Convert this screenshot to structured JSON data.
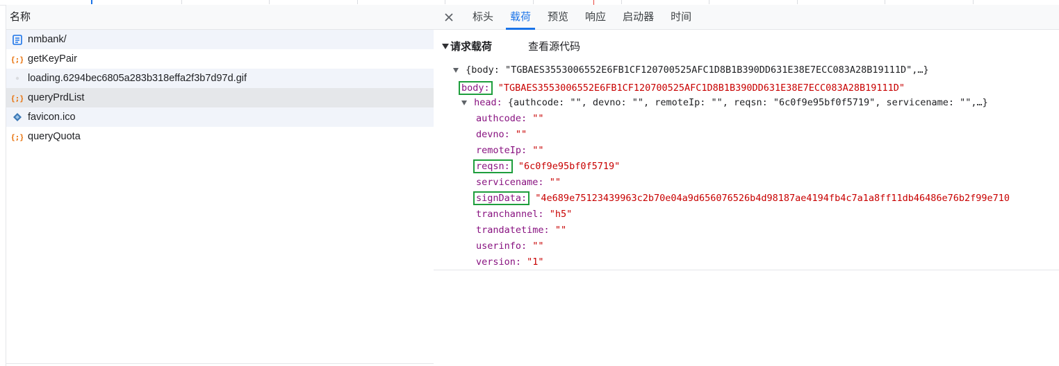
{
  "requests_panel": {
    "header": "名称",
    "items": [
      {
        "name": "nmbank/",
        "icon": "document-icon",
        "state": "alt"
      },
      {
        "name": "getKeyPair",
        "icon": "fetch-icon",
        "state": "plain"
      },
      {
        "name": "loading.6294bec6805a283b318effa2f3b7d97d.gif",
        "icon": "image-icon",
        "state": "alt"
      },
      {
        "name": "queryPrdList",
        "icon": "fetch-icon",
        "state": "selected"
      },
      {
        "name": "favicon.ico",
        "icon": "favicon-icon",
        "state": "alt"
      },
      {
        "name": "queryQuota",
        "icon": "fetch-icon",
        "state": "plain"
      }
    ]
  },
  "detail": {
    "close_icon": "close-icon",
    "tabs": [
      "标头",
      "载荷",
      "预览",
      "响应",
      "启动器",
      "时间"
    ],
    "active_tab": "载荷",
    "payload": {
      "section_title": "请求载荷",
      "view_source": "查看源代码",
      "summary": "{body: \"TGBAES3553006552E6FB1CF120700525AFC1D8B1B390DD631E38E7ECC083A28B19111D\",…}",
      "body_key": "body:",
      "body_value": "\"TGBAES3553006552E6FB1CF120700525AFC1D8B1B390DD631E38E7ECC083A28B19111D\"",
      "head_key": "head:",
      "head_summary": "{authcode: \"\", devno: \"\", remoteIp: \"\", reqsn: \"6c0f9e95bf0f5719\", servicename: \"\",…}",
      "fields": [
        {
          "key": "authcode:",
          "value": "\"\"",
          "highlight": false
        },
        {
          "key": "devno:",
          "value": "\"\"",
          "highlight": false
        },
        {
          "key": "remoteIp:",
          "value": "\"\"",
          "highlight": false
        },
        {
          "key": "reqsn:",
          "value": "\"6c0f9e95bf0f5719\"",
          "highlight": true
        },
        {
          "key": "servicename:",
          "value": "\"\"",
          "highlight": false
        },
        {
          "key": "signData:",
          "value": "\"4e689e75123439963c2b70e04a9d656076526b4d98187ae4194fb4c7a1a8ff11db46486e76b2f99e710",
          "highlight": true
        },
        {
          "key": "tranchannel:",
          "value": "\"h5\"",
          "highlight": false
        },
        {
          "key": "trandatetime:",
          "value": "\"\"",
          "highlight": false
        },
        {
          "key": "userinfo:",
          "value": "\"\"",
          "highlight": false
        },
        {
          "key": "version:",
          "value": "\"1\"",
          "highlight": false
        }
      ]
    }
  },
  "colors": {
    "accent": "#1a73e8",
    "highlight_box": "#1e9e3c",
    "key": "#881280",
    "string": "#c80000"
  }
}
